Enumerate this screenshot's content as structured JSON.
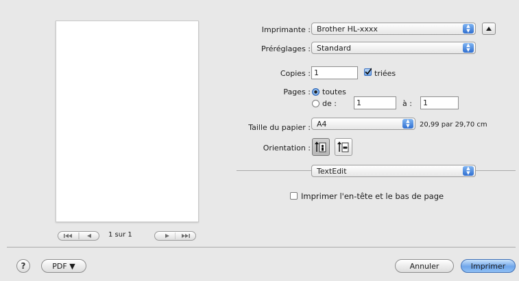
{
  "printer": {
    "label": "Imprimante :",
    "value": "Brother HL-xxxx"
  },
  "presets": {
    "label": "Préréglages :",
    "value": "Standard"
  },
  "copies": {
    "label": "Copies :",
    "value": "1",
    "collated_label": "triées",
    "collated_checked": true
  },
  "pages": {
    "label": "Pages :",
    "all_label": "toutes",
    "from_label": "de :",
    "from_value": "1",
    "to_label": "à :",
    "to_value": "1"
  },
  "paper_size": {
    "label": "Taille du papier :",
    "value": "A4",
    "dimensions": "20,99 par 29,70 cm"
  },
  "orientation": {
    "label": "Orientation :"
  },
  "app_section": {
    "value": "TextEdit"
  },
  "header_footer": {
    "label": "Imprimer l'en-tête et le bas de page",
    "checked": false
  },
  "preview_nav": {
    "page_indicator": "1 sur 1"
  },
  "footer": {
    "help_glyph": "?",
    "pdf_label": "PDF ▼",
    "cancel_label": "Annuler",
    "print_label": "Imprimer"
  }
}
